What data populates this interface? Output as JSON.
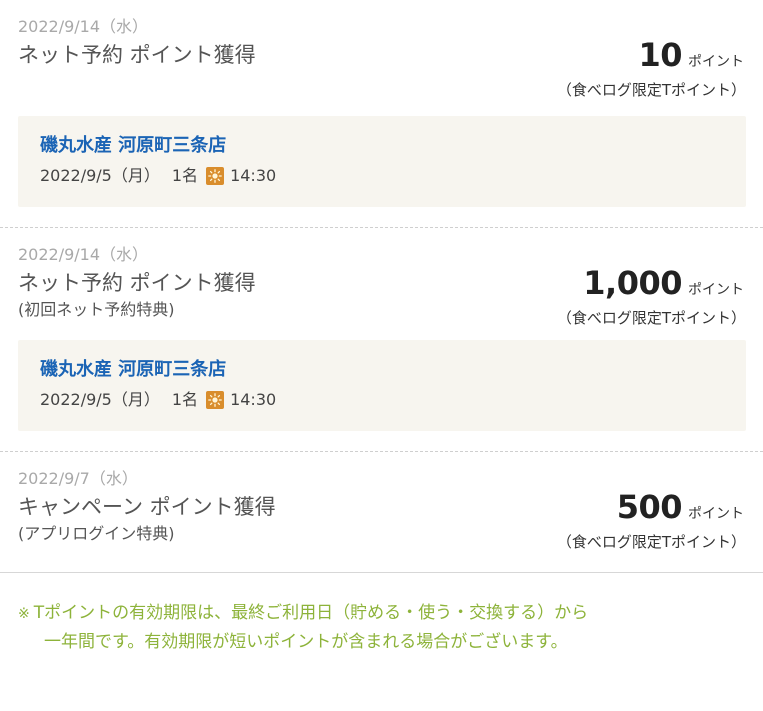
{
  "entries": [
    {
      "date": "2022/9/14（水）",
      "title": "ネット予約 ポイント獲得",
      "subtitle": "",
      "points": "10",
      "points_unit": "ポイント",
      "points_type": "（食べログ限定Tポイント）",
      "restaurant": {
        "name": "磯丸水産 河原町三条店",
        "date": "2022/9/5（月）",
        "people": "1名",
        "time_icon": "sun-icon",
        "time": "14:30"
      }
    },
    {
      "date": "2022/9/14（水）",
      "title": "ネット予約 ポイント獲得",
      "subtitle": "(初回ネット予約特典)",
      "points": "1,000",
      "points_unit": "ポイント",
      "points_type": "（食べログ限定Tポイント）",
      "restaurant": {
        "name": "磯丸水産 河原町三条店",
        "date": "2022/9/5（月）",
        "people": "1名",
        "time_icon": "sun-icon",
        "time": "14:30"
      }
    },
    {
      "date": "2022/9/7（水）",
      "title": "キャンペーン ポイント獲得",
      "subtitle": "(アプリログイン特典)",
      "points": "500",
      "points_unit": "ポイント",
      "points_type": "（食べログ限定Tポイント）"
    }
  ],
  "note": {
    "mark": "※",
    "line1": "Tポイントの有効期限は、最終ご利用日（貯める・使う・交換する）から",
    "line2": "一年間です。有効期限が短いポイントが含まれる場合がございます。"
  },
  "colors": {
    "restaurant_link": "#1b64b5",
    "note_text": "#8db33a",
    "card_background": "#f7f5ef",
    "sun_icon_background": "#d98d2c"
  }
}
